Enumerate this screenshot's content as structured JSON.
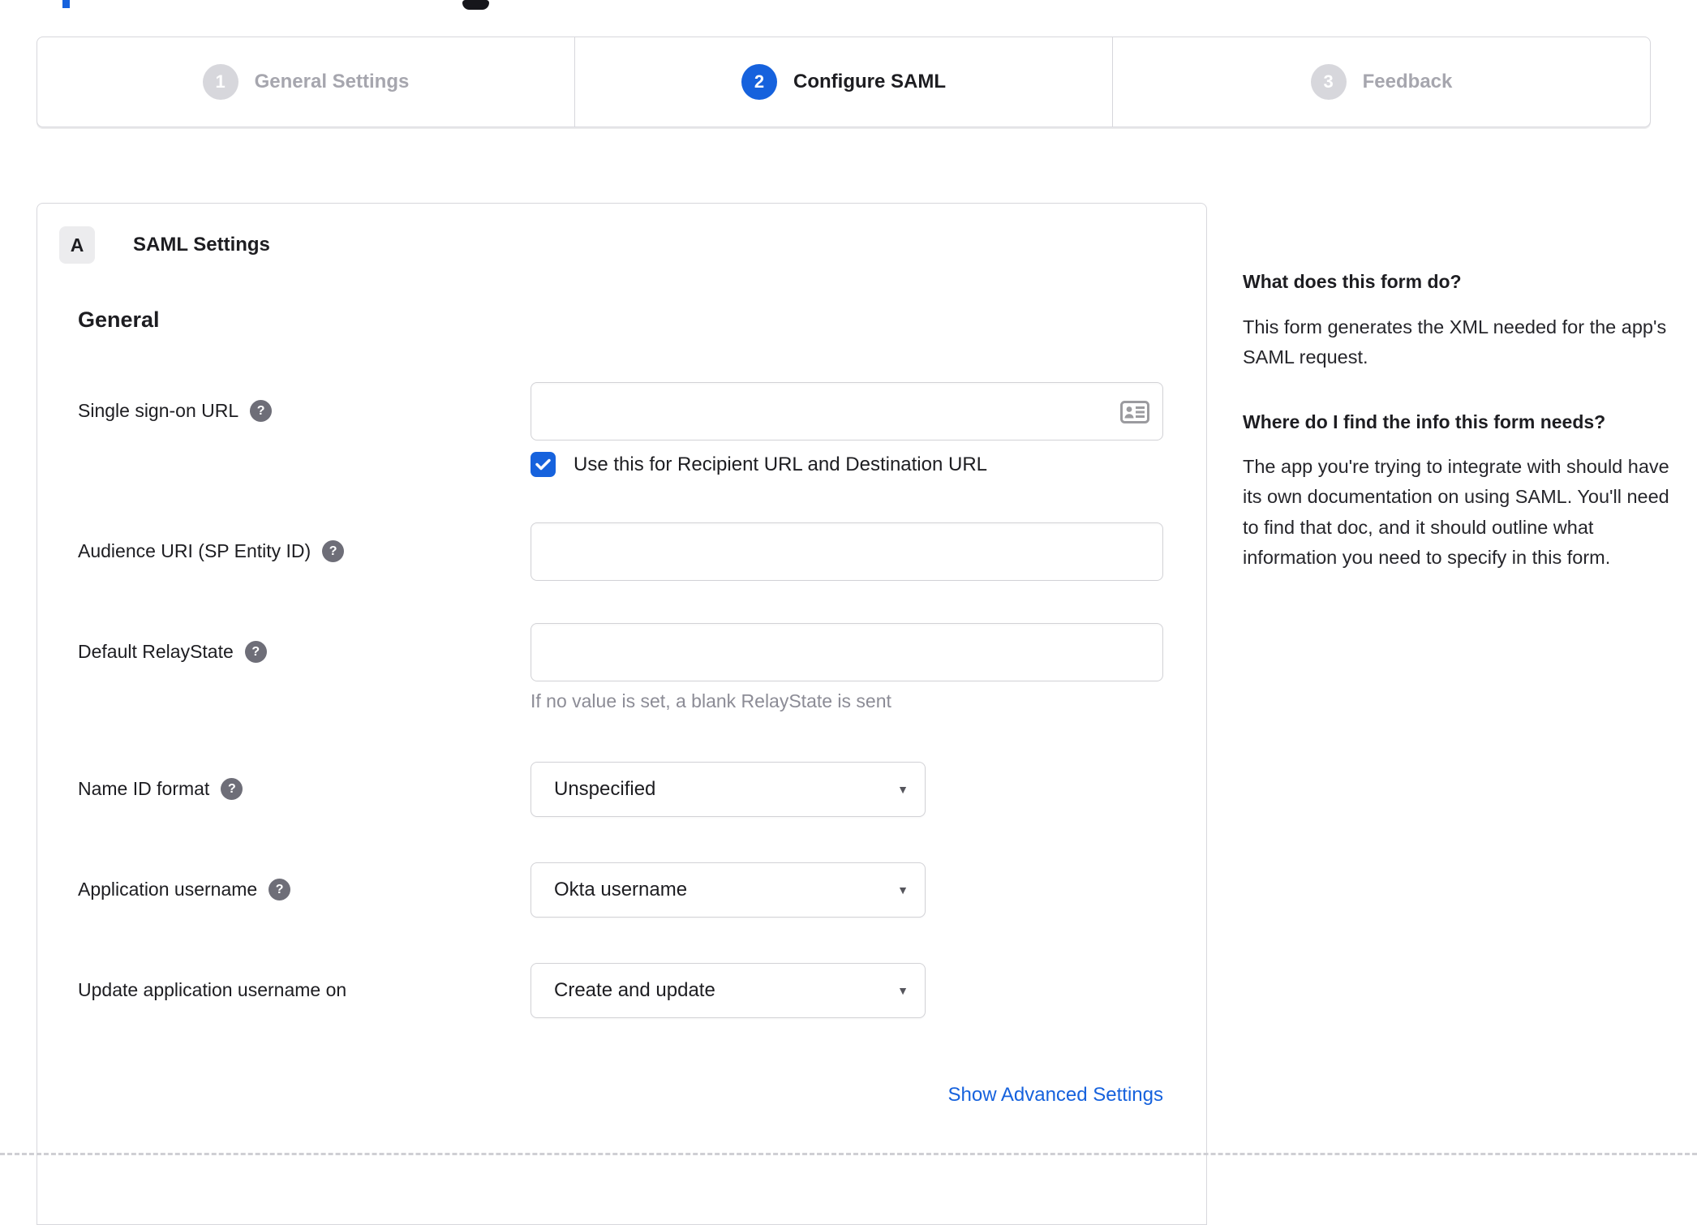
{
  "stepper": {
    "steps": [
      {
        "number": "1",
        "label": "General Settings",
        "state": "inactive"
      },
      {
        "number": "2",
        "label": "Configure SAML",
        "state": "active"
      },
      {
        "number": "3",
        "label": "Feedback",
        "state": "inactive"
      }
    ]
  },
  "panel": {
    "section_badge": "A",
    "section_title": "SAML Settings",
    "group_heading": "General",
    "fields": {
      "sso_url": {
        "label": "Single sign-on URL",
        "value": "",
        "checkbox_label": "Use this for Recipient URL and Destination URL",
        "checkbox_checked": true
      },
      "audience_uri": {
        "label": "Audience URI (SP Entity ID)",
        "value": ""
      },
      "default_relaystate": {
        "label": "Default RelayState",
        "value": "",
        "hint": "If no value is set, a blank RelayState is sent"
      },
      "name_id_format": {
        "label": "Name ID format",
        "value": "Unspecified"
      },
      "application_username": {
        "label": "Application username",
        "value": "Okta username"
      },
      "update_application_username_on": {
        "label": "Update application username on",
        "value": "Create and update"
      }
    },
    "advanced_link": "Show Advanced Settings"
  },
  "sidebar": {
    "sections": [
      {
        "heading": "What does this form do?",
        "body": "This form generates the XML needed for the app's SAML request."
      },
      {
        "heading": "Where do I find the info this form needs?",
        "body": "The app you're trying to integrate with should have its own documentation on using SAML. You'll need to find that doc, and it should outline what information you need to specify in this form."
      }
    ]
  },
  "colors": {
    "accent_blue": "#1662dd",
    "border_gray": "#d7d7dc",
    "text_dark": "#1d1d21",
    "muted_gray": "#8c8c96",
    "step_inactive": "#d7d7dc",
    "help_icon_gray": "#6e6e78"
  }
}
